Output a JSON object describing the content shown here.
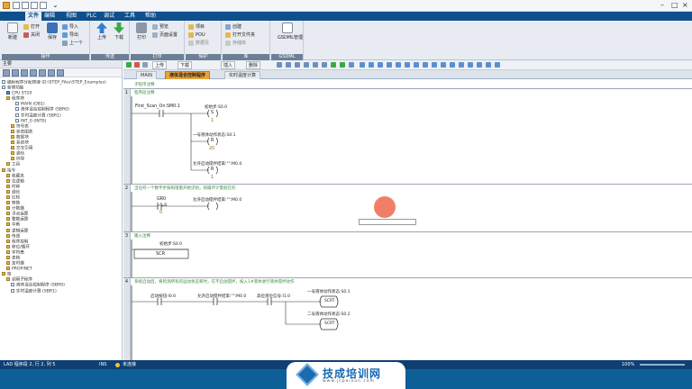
{
  "menus": [
    "文件",
    "编辑",
    "视图",
    "PLC",
    "调试",
    "工具",
    "帮助"
  ],
  "ribbon": {
    "groups": [
      {
        "label": "操作",
        "big": [
          "新建",
          "保存"
        ],
        "small": [
          "打开",
          "关闭",
          "导入",
          "导出",
          "上一个"
        ]
      },
      {
        "label": "传送",
        "big": [
          "上传",
          "下载"
        ],
        "small": []
      },
      {
        "label": "打印",
        "big": [
          "打印"
        ],
        "small": [
          "预览",
          "页面设置"
        ]
      },
      {
        "label": "保护",
        "big": [],
        "small": [
          "项目",
          "POU",
          "数据页"
        ]
      },
      {
        "label": "库",
        "big": [],
        "small": [
          "创建",
          "打开文件夹",
          "存储库"
        ]
      },
      {
        "label": "GSDML",
        "big": [
          "GSDML管理"
        ],
        "small": []
      }
    ]
  },
  "left_pane": {
    "header": "主要",
    "tree": [
      "编程程序分配管理 (D:\\STEP_Files\\STEP_Examples)",
      "新增功能",
      "CPU ST20",
      "程序块",
      "MAIN (OB1)",
      "液体混合控制程序 (SBR0)",
      "实时温度计算 (SBR1)",
      "INT_0 (INT0)",
      "符号表",
      "状态图表",
      "数据块",
      "系统块",
      "交叉引用",
      "通信",
      "向导",
      "工具",
      "指令",
      "收藏夹",
      "位逻辑",
      "时钟",
      "通信",
      "比较",
      "转换",
      "计数器",
      "浮点运算",
      "整数运算",
      "中断",
      "逻辑运算",
      "传送",
      "程序控制",
      "移位/循环",
      "字符串",
      "表格",
      "定时器",
      "PROFINET",
      "库",
      "调用子程序",
      "液体混合控制程序 (SBR0)",
      "实时温度计算 (SBR1)"
    ]
  },
  "editor_tabs": [
    "MAIN",
    "液体混合控制程序",
    "实时温度计算"
  ],
  "toolbar2": {
    "upload": "上传",
    "download": "下载",
    "insert": "插入",
    "delete": "删除"
  },
  "program_comment": "子程序注释",
  "rungs": [
    {
      "num": "1",
      "comment": "程序段注释",
      "contact": "First_Scan_On:SM0.1",
      "coils": [
        {
          "name": "初始步:S0.0",
          "op": "S",
          "param": "1"
        },
        {
          "name": "一号液体动作状态:S0.1",
          "op": "R",
          "param": "20"
        },
        {
          "name": "允许启动搅拌结束:\"\":M0.0",
          "op": "R",
          "param": "1"
        }
      ]
    },
    {
      "num": "2",
      "comment": "当任何一个数字步按照增量开始识别，则循环计量就在的",
      "contact": "GR0",
      "contact_sub": "==B",
      "contact_val": "0",
      "coil": "允许启动搅拌结束:\"\":M0.0"
    },
    {
      "num": "3",
      "comment": "输入注释",
      "label": "初始步:S0.0",
      "box": "SCR"
    },
    {
      "num": "4",
      "comment": "系统启动后，将检测所有的运动状态和时，在不启动搅拌，按入1#液体进行液体搅拌动作",
      "contacts": [
        "启动按钮:I0.0",
        "允许启动搅拌结束:\"\":M0.0",
        "高位液位信号:I1.0"
      ],
      "branches": [
        {
          "name": "一号液体动作状态:S0.1",
          "op": "SCRT"
        },
        {
          "name": "二号液体动作状态:S0.2",
          "op": "SCRT"
        }
      ]
    }
  ],
  "status": {
    "left": "LAD 程序段 2, 行 2, 列 5",
    "mode": "INS",
    "conn": "未连接",
    "zoom": "100%"
  },
  "brand": {
    "name": "技成培训网",
    "url": "www.jcpeixun.com"
  }
}
